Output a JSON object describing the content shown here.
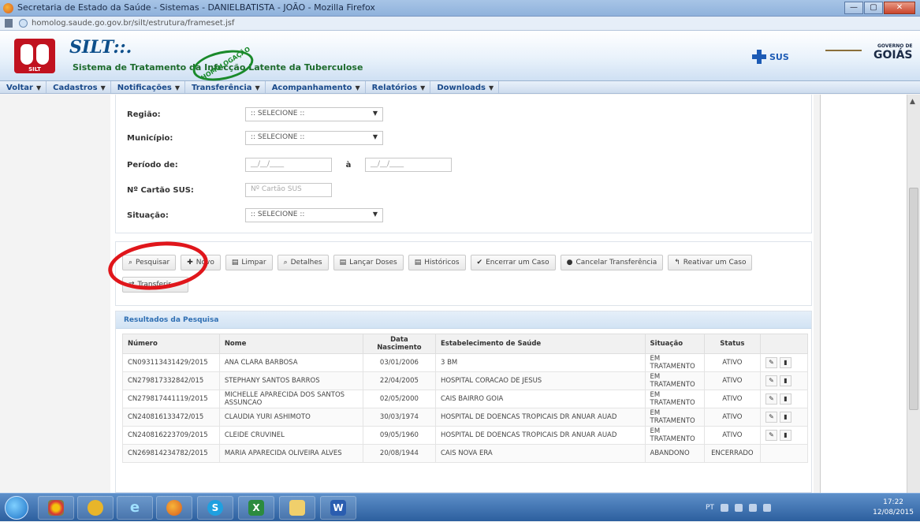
{
  "window": {
    "title": "Secretaria de Estado da Saúde - Sistemas - DANIELBATISTA - JOÃO - Mozilla Firefox",
    "buttons": [
      "—",
      "▢",
      "✕"
    ],
    "url": "homolog.saude.go.gov.br/silt/estrutura/frameset.jsf"
  },
  "header": {
    "logo_text": "SILT",
    "app_name": "SILT::.",
    "subtitle": "Sistema de Tratamento da Infecção Latente da Tuberculose",
    "stamp_text": "HOMOLOGAÇÃO",
    "sus_label": "SUS",
    "goias_small": "GOVERNO DE",
    "goias_big": "GOIÁS"
  },
  "menu": [
    {
      "label": "Voltar"
    },
    {
      "label": "Cadastros"
    },
    {
      "label": "Notificações"
    },
    {
      "label": "Transferência"
    },
    {
      "label": "Acompanhamento"
    },
    {
      "label": "Relatórios"
    },
    {
      "label": "Downloads"
    }
  ],
  "form": {
    "regiao_label": "Região:",
    "regiao_value": ":: SELECIONE ::",
    "municipio_label": "Município:",
    "municipio_value": ":: SELECIONE ::",
    "periodo_label": "Período de:",
    "periodo_from": "__/__/____",
    "periodo_sep": "à",
    "periodo_to": "__/__/____",
    "cartao_label": "Nº Cartão SUS:",
    "cartao_placeholder": "Nº Cartão SUS",
    "situacao_label": "Situação:",
    "situacao_value": ":: SELECIONE ::"
  },
  "actions": {
    "pesquisar": "Pesquisar",
    "novo": "Novo",
    "limpar": "Limpar",
    "detalhes": "Detalhes",
    "lancar_doses": "Lançar Doses",
    "historicos": "Históricos",
    "encerrar": "Encerrar um Caso",
    "cancelar": "Cancelar Transferência",
    "reativar": "Reativar um Caso",
    "transferir": "Transferir"
  },
  "results": {
    "title": "Resultados da Pesquisa",
    "columns": [
      "Número",
      "Nome",
      "Data Nascimento",
      "Estabelecimento de Saúde",
      "Situação",
      "Status",
      ""
    ],
    "rows": [
      {
        "numero": "CN093113431429/2015",
        "nome": "ANA CLARA BARBOSA",
        "nasc": "03/01/2006",
        "estab": "3 BM",
        "situacao": "EM TRATAMENTO",
        "status": "ATIVO"
      },
      {
        "numero": "CN279817332842/015",
        "nome": "STEPHANY SANTOS BARROS",
        "nasc": "22/04/2005",
        "estab": "HOSPITAL CORACAO DE JESUS",
        "situacao": "EM TRATAMENTO",
        "status": "ATIVO"
      },
      {
        "numero": "CN279817441119/2015",
        "nome": "MICHELLE APARECIDA DOS SANTOS ASSUNCAO",
        "nasc": "02/05/2000",
        "estab": "CAIS BAIRRO GOIA",
        "situacao": "EM TRATAMENTO",
        "status": "ATIVO"
      },
      {
        "numero": "CN240816133472/015",
        "nome": "CLAUDIA YURI ASHIMOTO",
        "nasc": "30/03/1974",
        "estab": "HOSPITAL DE DOENCAS TROPICAIS DR ANUAR AUAD",
        "situacao": "EM TRATAMENTO",
        "status": "ATIVO"
      },
      {
        "numero": "CN240816223709/2015",
        "nome": "CLEIDE CRUVINEL",
        "nasc": "09/05/1960",
        "estab": "HOSPITAL DE DOENCAS TROPICAIS DR ANUAR AUAD",
        "situacao": "EM TRATAMENTO",
        "status": "ATIVO"
      },
      {
        "numero": "CN269814234782/2015",
        "nome": "MARIA APARECIDA OLIVEIRA ALVES",
        "nasc": "20/08/1944",
        "estab": "CAIS NOVA ERA",
        "situacao": "ABANDONO",
        "status": "ENCERRADO"
      }
    ]
  },
  "taskbar": {
    "apps": [
      "Chrome",
      "Opera",
      "IE",
      "Firefox",
      "Skype",
      "Excel",
      "Explorer",
      "Word"
    ],
    "language": "PT",
    "time": "17:22",
    "date": "12/08/2015"
  }
}
